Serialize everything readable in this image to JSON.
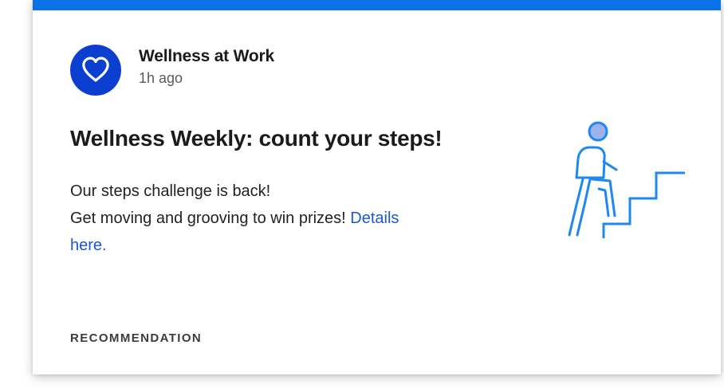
{
  "post": {
    "author": "Wellness at Work",
    "timestamp": "1h ago",
    "headline": "Wellness Weekly: count your steps!",
    "body_line1": "Our steps challenge is back!",
    "body_line2_prefix": "Get moving and grooving to win prizes! ",
    "link_text_part1": "Details",
    "link_text_part2": "here."
  },
  "section": {
    "label": "RECOMMENDATION"
  },
  "icons": {
    "avatar": "heart-icon",
    "illustration": "person-climbing-stairs-icon"
  },
  "colors": {
    "accent_bar": "#0b72e7",
    "avatar_bg": "#0b3fd0",
    "link": "#1a56d6",
    "illustration_stroke": "#1e88f0",
    "illustration_head": "#9eb3ee"
  }
}
